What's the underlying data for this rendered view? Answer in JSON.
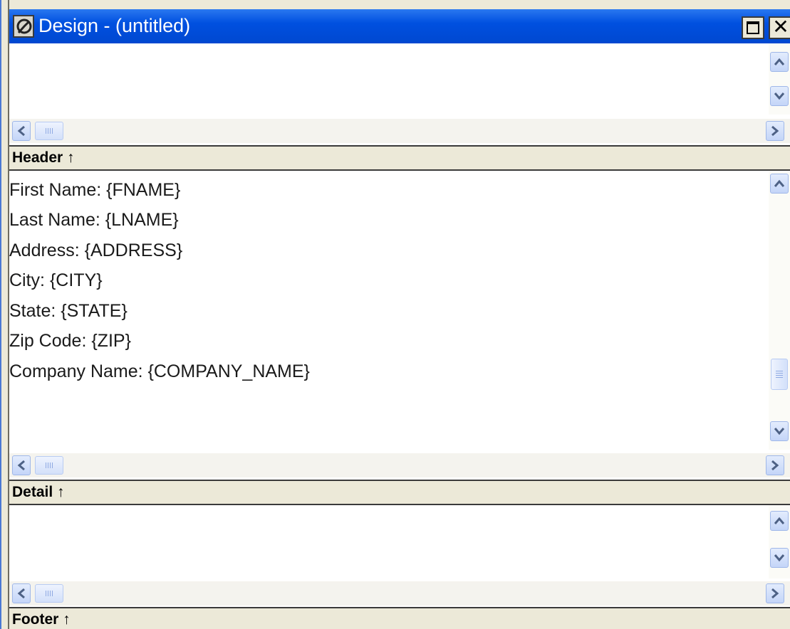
{
  "window": {
    "title": "Design - (untitled)",
    "maximize_glyph": "",
    "close_glyph": "✕",
    "icon": "app-logo-icon"
  },
  "bands": [
    {
      "label": "Header ↑"
    },
    {
      "label": "Detail ↑"
    },
    {
      "label": "Footer ↑"
    }
  ],
  "header_fields": [
    "First Name: {FNAME}",
    "Last Name: {LNAME}",
    "Address: {ADDRESS}",
    "City: {CITY}",
    "State: {STATE}",
    "Zip Code: {ZIP}",
    "Company Name: {COMPANY_NAME}"
  ],
  "icons": {
    "scroll_up": "chevron-up-icon",
    "scroll_down": "chevron-down-icon",
    "scroll_left": "chevron-left-icon",
    "scroll_right": "chevron-right-icon",
    "maximize": "maximize-icon",
    "close": "close-icon"
  },
  "colors": {
    "titlebar": "#0055e5",
    "band": "#ece9d8",
    "scroll_button": "#c4d5f8"
  }
}
